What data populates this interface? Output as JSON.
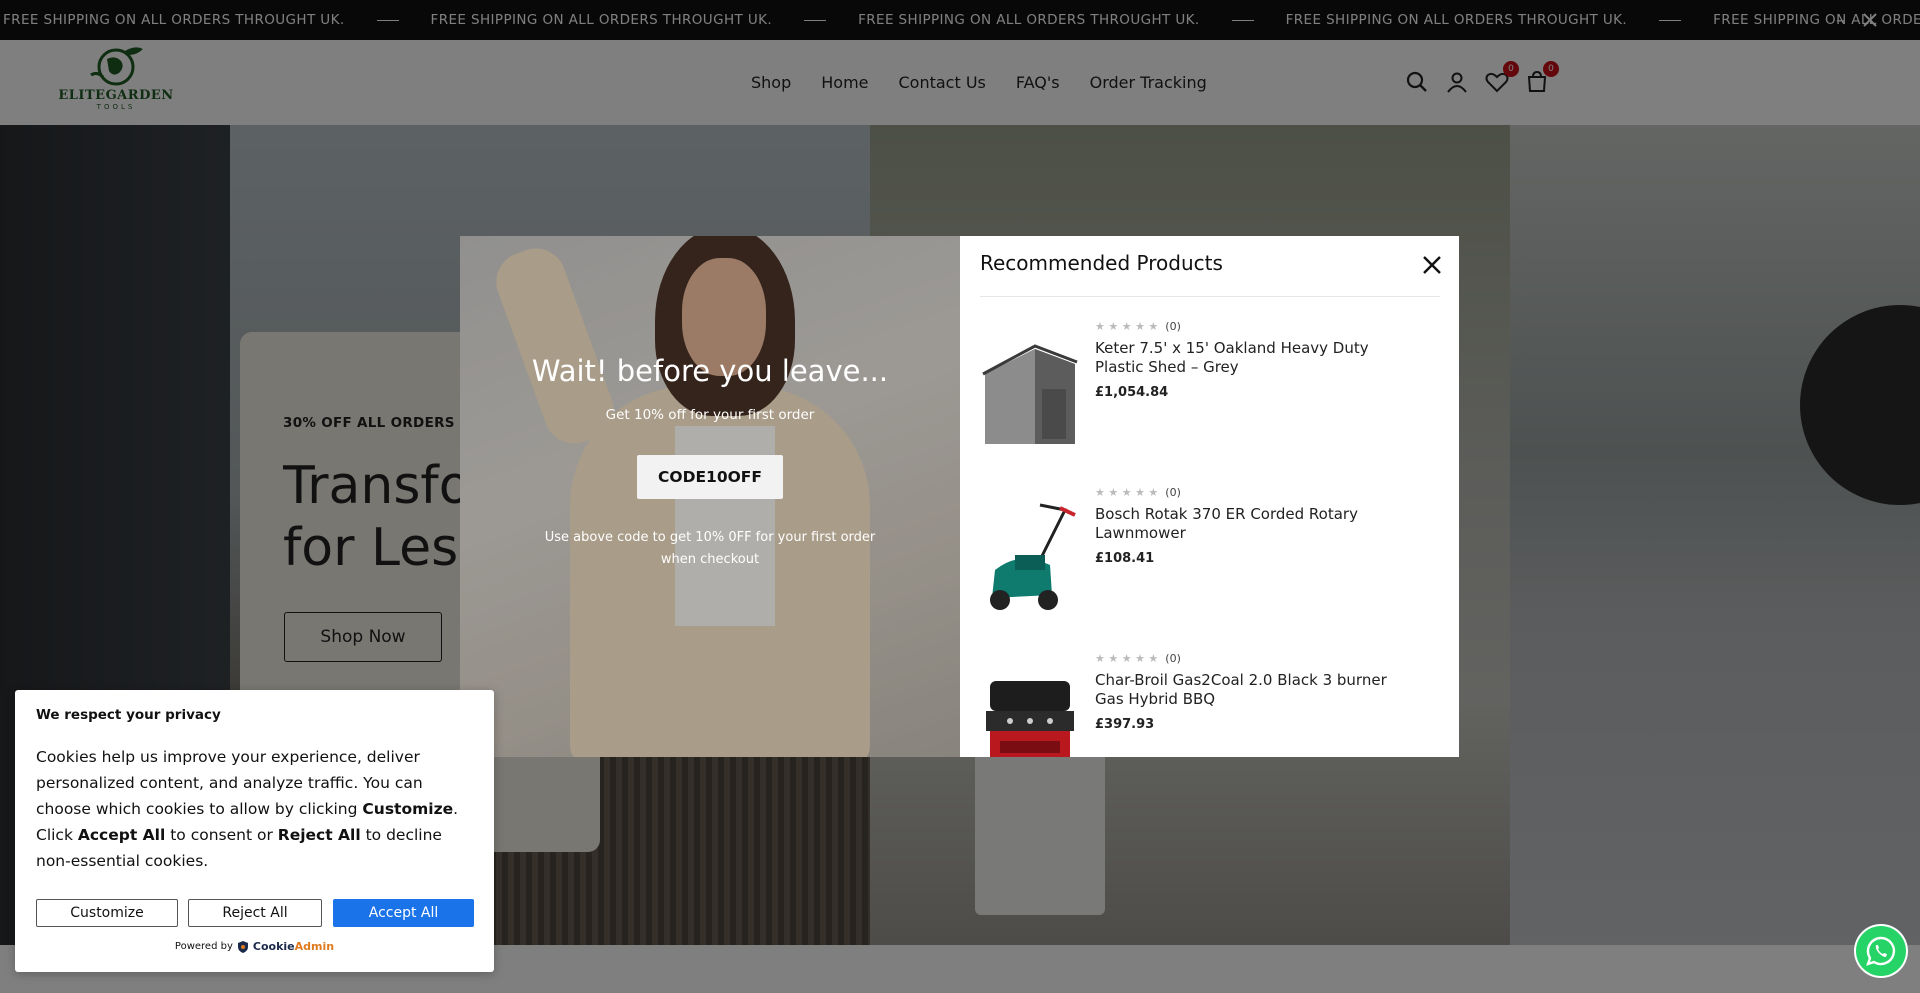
{
  "announcement": {
    "message": "FREE SHIPPING ON ALL ORDERS THROUGHT UK.",
    "repeat": 5
  },
  "header": {
    "logo_text": "ELITEGARDEN",
    "logo_sub": "TOOLS",
    "nav": [
      "Shop",
      "Home",
      "Contact Us",
      "FAQ's",
      "Order Tracking"
    ],
    "wishlist_count": "0",
    "cart_count": "0"
  },
  "hero": {
    "eyebrow": "30% OFF ALL ORDERS",
    "title_line1": "Transfo",
    "title_line2": "for Less",
    "cta": "Shop Now"
  },
  "exit_popup": {
    "heading": "Wait! before you leave...",
    "subheading": "Get 10% off for your first order",
    "code": "CODE10OFF",
    "note": "Use above code to get 10% 0FF for your first order when checkout",
    "recommended_title": "Recommended Products",
    "products": [
      {
        "name": "Keter 7.5' x 15' Oakland Heavy Duty Plastic Shed – Grey",
        "price": "£1,054.84",
        "reviews": "(0)"
      },
      {
        "name": "Bosch Rotak 370 ER Corded Rotary Lawnmower",
        "price": "£108.41",
        "reviews": "(0)"
      },
      {
        "name": "Char-Broil Gas2Coal 2.0 Black 3 burner Gas Hybrid BBQ",
        "price": "£397.93",
        "reviews": "(0)"
      }
    ]
  },
  "cookie": {
    "title": "We respect your privacy",
    "body_1": "Cookies help us improve your experience, deliver personalized content, and analyze traffic. You can choose which cookies to allow by clicking ",
    "body_customize": "Customize",
    "body_2": ". Click ",
    "body_accept": "Accept All",
    "body_3": " to consent or ",
    "body_reject": "Reject All",
    "body_4": " to decline non-essential cookies.",
    "btn_customize": "Customize",
    "btn_reject": "Reject All",
    "btn_accept": "Accept All",
    "powered_by": "Powered by",
    "brand_cookie": "Cookie",
    "brand_admin": "Admin"
  },
  "colors": {
    "accent_blue": "#1a73e8",
    "badge_red": "#c80f18",
    "brand_green": "#1f5a23",
    "whatsapp_green": "#25d366"
  }
}
